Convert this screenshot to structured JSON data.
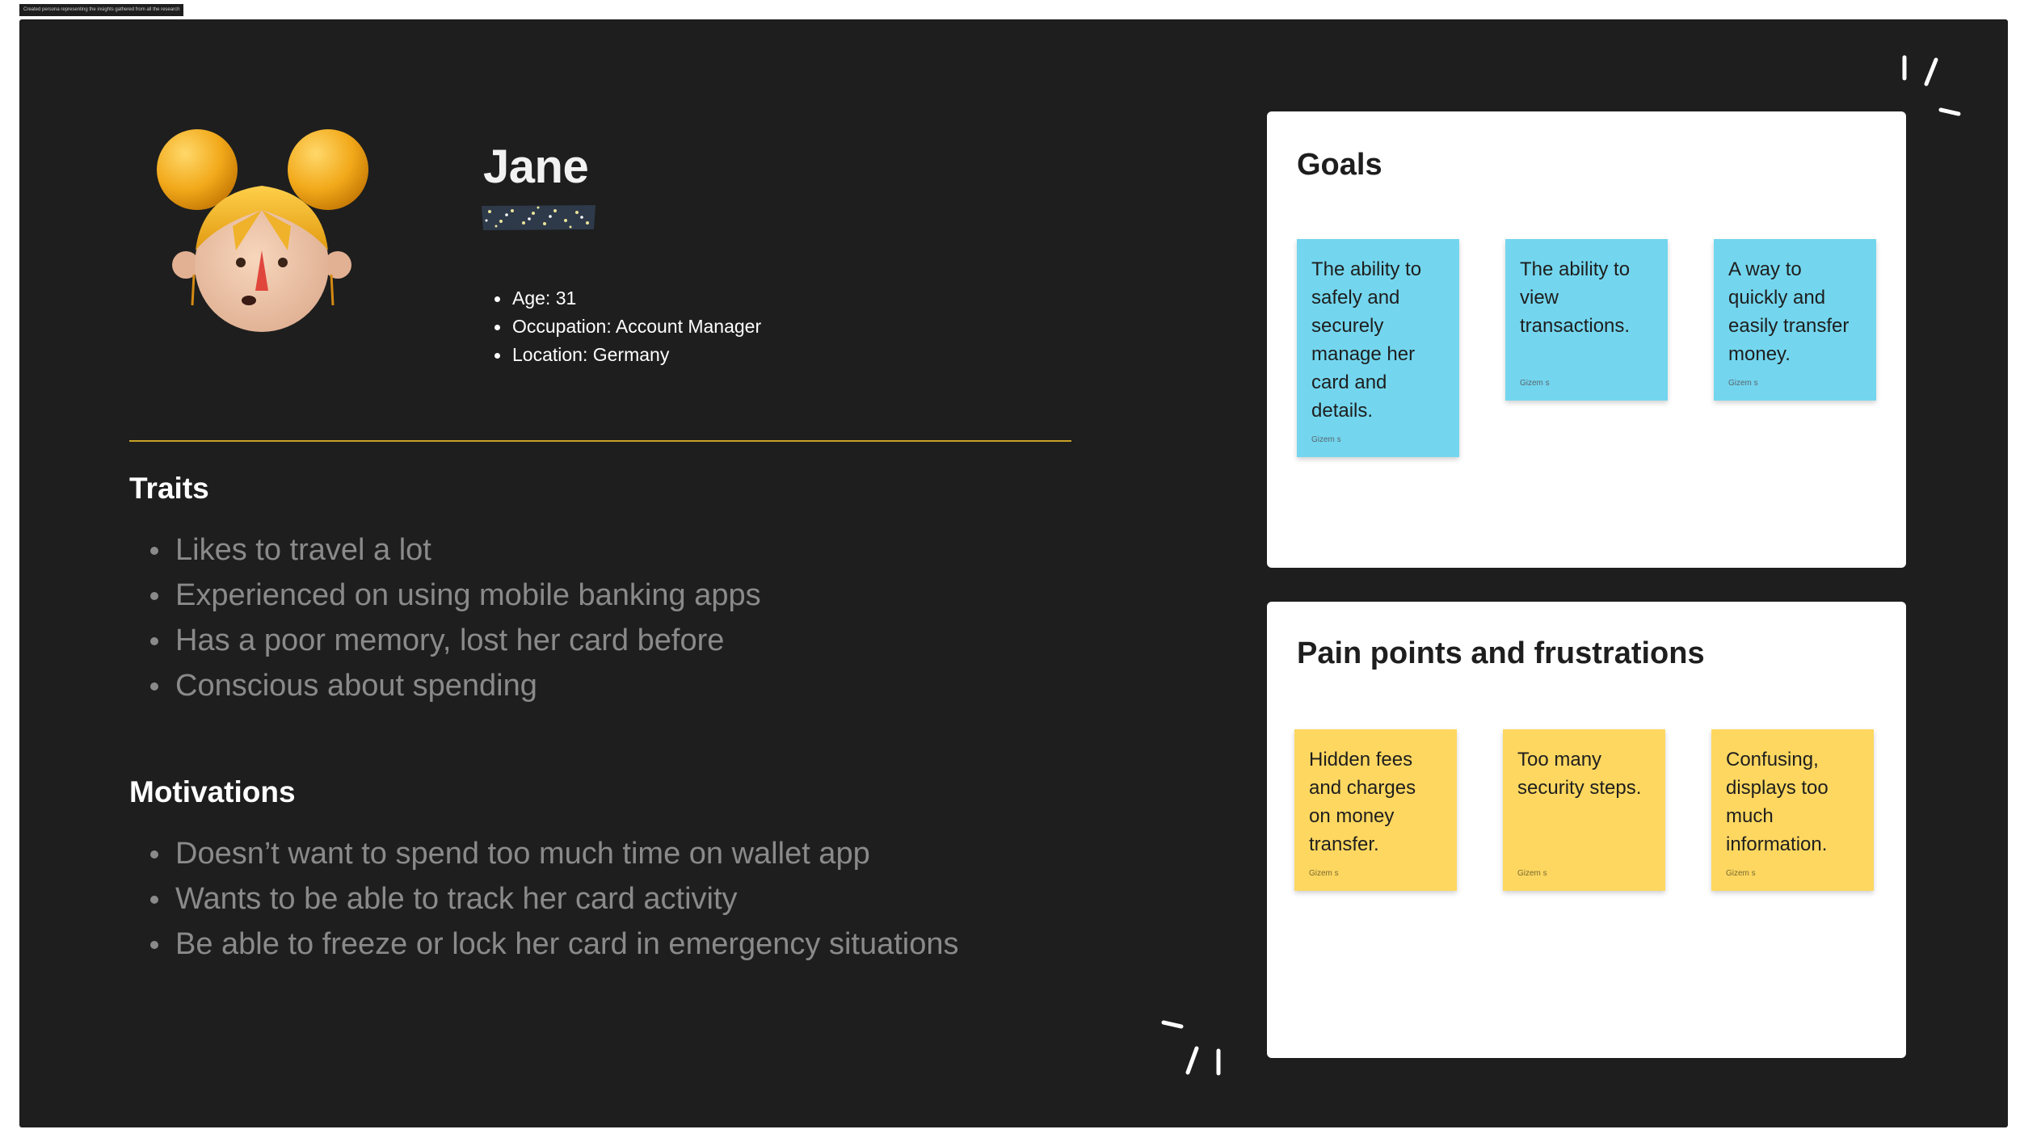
{
  "frame": {
    "label": "Created persona representing the insights gathered from all the research"
  },
  "persona": {
    "name": "Jane",
    "avatar_icon": "girl-with-buns-emoji-icon",
    "facts": [
      "Age: 31",
      "Occupation: Account Manager",
      "Location: Germany"
    ]
  },
  "traits": {
    "heading": "Traits",
    "items": [
      "Likes to travel a lot",
      "Experienced on using mobile banking apps",
      "Has a poor memory, lost her card before",
      "Conscious about spending"
    ]
  },
  "motivations": {
    "heading": "Motivations",
    "items": [
      "Doesn’t want to spend too much time on wallet app",
      "Wants to be able to track her card activity",
      "Be able to freeze or lock her card in emergency situations"
    ]
  },
  "goals": {
    "title": "Goals",
    "stickies": [
      {
        "text": "The ability to safely and securely manage her card and details.",
        "author": "Gizem s"
      },
      {
        "text": "The ability to view transactions.",
        "author": "Gizem s"
      },
      {
        "text": "A way to quickly and easily transfer money.",
        "author": "Gizem s"
      }
    ]
  },
  "pain_points": {
    "title": "Pain points and frustrations",
    "stickies": [
      {
        "text": "Hidden fees and charges on money transfer.",
        "author": "Gizem s"
      },
      {
        "text": "Too many security steps.",
        "author": "Gizem s"
      },
      {
        "text": "Confusing, displays too much information.",
        "author": "Gizem s"
      }
    ]
  },
  "colors": {
    "frame_bg": "#1e1e1e",
    "divider": "#c9a227",
    "goal_sticky": "#73d6ee",
    "pain_sticky": "#fdd760",
    "board_bg": "#ffffff"
  }
}
